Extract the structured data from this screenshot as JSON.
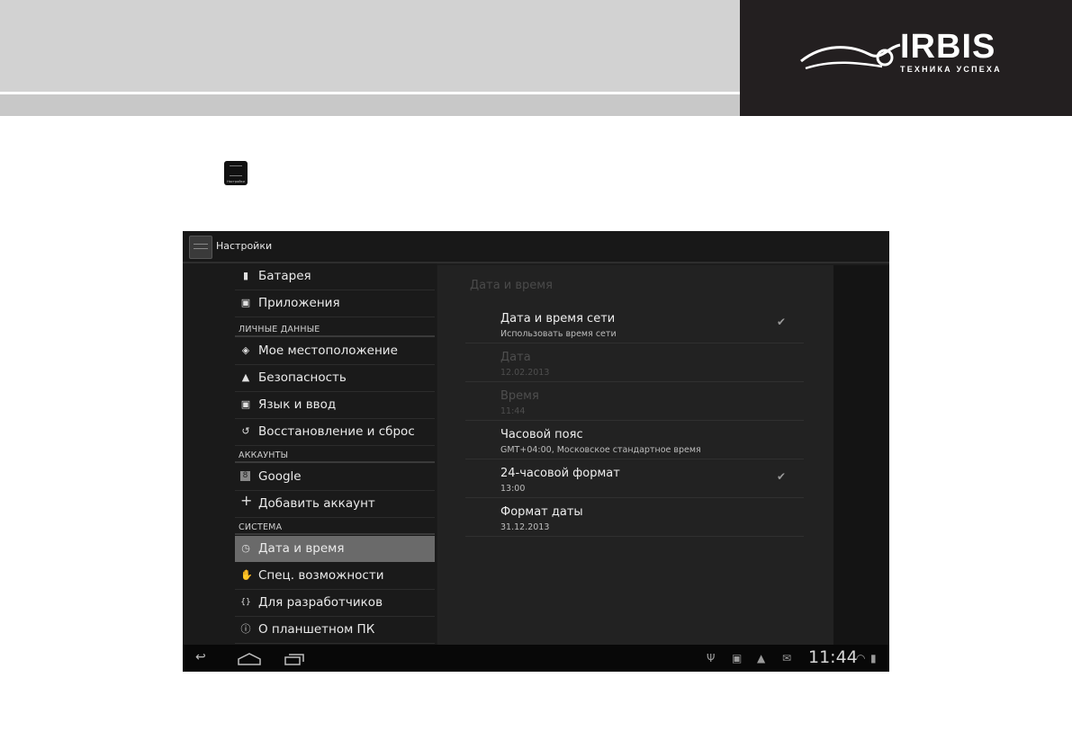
{
  "brand": {
    "name": "IRBIS",
    "tagline": "ТЕХНИКА УСПЕХА"
  },
  "launcher": {
    "icon_label": "Настройки"
  },
  "app": {
    "title": "Настройки"
  },
  "sidebar": {
    "items": [
      {
        "label": "Батарея",
        "icon": "battery-icon",
        "glyph": "▮"
      },
      {
        "label": "Приложения",
        "icon": "apps-icon",
        "glyph": "▣"
      },
      {
        "label": "Мое местоположение",
        "icon": "location-icon",
        "glyph": "◈"
      },
      {
        "label": "Безопасность",
        "icon": "lock-icon",
        "glyph": "▲"
      },
      {
        "label": "Язык и ввод",
        "icon": "keyboard-icon",
        "glyph": "▣"
      },
      {
        "label": "Восстановление и сброс",
        "icon": "restore-icon",
        "glyph": "↺"
      },
      {
        "label": "Google",
        "icon": "google-icon",
        "glyph": "8"
      },
      {
        "label": "Добавить аккаунт",
        "icon": "plus-icon",
        "glyph": "+"
      },
      {
        "label": "Дата и время",
        "icon": "clock-icon",
        "glyph": "◷",
        "selected": true
      },
      {
        "label": "Спец. возможности",
        "icon": "hand-icon",
        "glyph": "✋"
      },
      {
        "label": "Для разработчиков",
        "icon": "braces-icon",
        "glyph": "{}"
      },
      {
        "label": "О планшетном ПК",
        "icon": "info-icon",
        "glyph": "ⓘ"
      }
    ],
    "sections": {
      "personal": "ЛИЧНЫЕ ДАННЫЕ",
      "accounts": "АККАУНТЫ",
      "system": "СИСТЕМА"
    }
  },
  "main": {
    "title": "Дата и время",
    "rows": [
      {
        "title": "Дата и время сети",
        "summary": "Использовать время сети",
        "checked": true,
        "enabled": true
      },
      {
        "title": "Дата",
        "summary": "12.02.2013",
        "enabled": false
      },
      {
        "title": "Время",
        "summary": "11:44",
        "enabled": false
      },
      {
        "title": "Часовой пояс",
        "summary": "GMT+04:00, Московское стандартное время",
        "enabled": true
      },
      {
        "title": "24-часовой формат",
        "summary": "13:00",
        "checked": true,
        "enabled": true
      },
      {
        "title": "Формат даты",
        "summary": "31.12.2013",
        "enabled": true
      }
    ]
  },
  "statusbar": {
    "time": "11:44"
  },
  "colors": {
    "accent_selected": "#6a6a6a",
    "background": "#1c1c1c",
    "header_dark": "#231f20"
  }
}
